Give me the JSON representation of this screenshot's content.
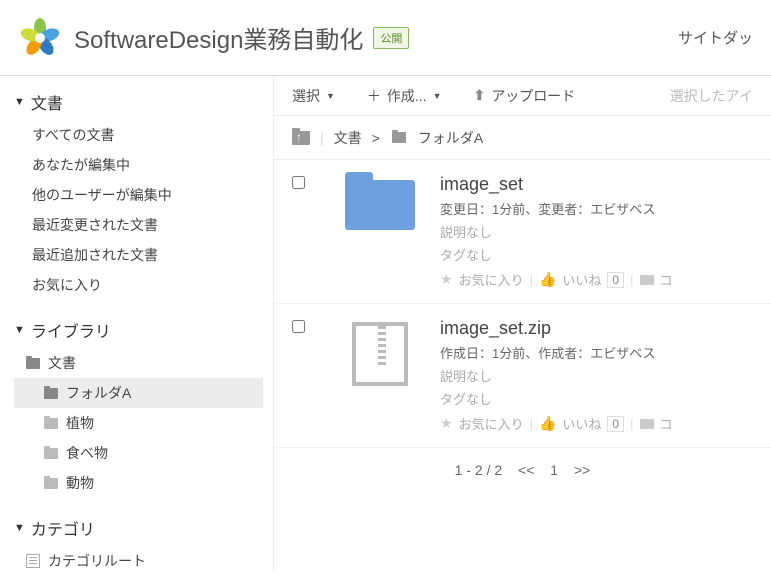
{
  "header": {
    "site_title": "SoftwareDesign業務自動化",
    "badge": "公開",
    "right_link": "サイトダッ"
  },
  "sidebar": {
    "docs": {
      "heading": "文書",
      "items": [
        "すべての文書",
        "あなたが編集中",
        "他のユーザーが編集中",
        "最近変更された文書",
        "最近追加された文書",
        "お気に入り"
      ]
    },
    "library": {
      "heading": "ライブラリ",
      "root": "文書",
      "children": [
        "フォルダA",
        "植物",
        "食べ物",
        "動物"
      ],
      "selected_index": 0
    },
    "category": {
      "heading": "カテゴリ",
      "root": "カテゴリルート"
    }
  },
  "toolbar": {
    "select": "選択",
    "create": "作成...",
    "upload": "アップロード",
    "selected_items": "選択したアイ"
  },
  "breadcrumb": {
    "root": "文書",
    "current": "フォルダA"
  },
  "items": [
    {
      "title": "image_set",
      "meta_line": "変更日：1分前、変更者：エビザベス",
      "description": "説明なし",
      "tags": "タグなし",
      "fav": "お気に入り",
      "like": "いいね",
      "like_count": "0",
      "comment": "コ",
      "type": "folder"
    },
    {
      "title": "image_set.zip",
      "meta_line": "作成日：1分前、作成者：エビザベス",
      "description": "説明なし",
      "tags": "タグなし",
      "fav": "お気に入り",
      "like": "いいね",
      "like_count": "0",
      "comment": "コ",
      "type": "zip"
    }
  ],
  "pager": {
    "range": "1 - 2 / 2",
    "prev": "<<",
    "page": "1",
    "next": ">>"
  }
}
